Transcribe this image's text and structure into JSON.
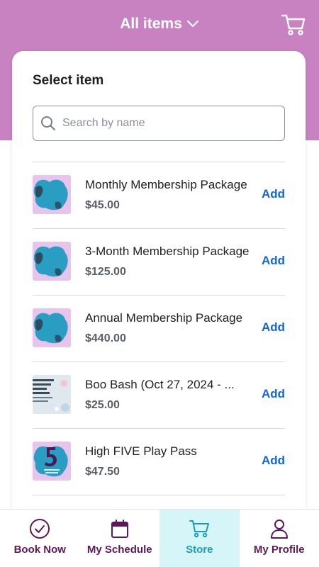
{
  "header": {
    "title": "All items"
  },
  "sheet": {
    "title": "Select item"
  },
  "search": {
    "placeholder": "Search by name"
  },
  "items": [
    {
      "name": "Monthly Membership Package",
      "price": "$45.00",
      "add_label": "Add",
      "thumb": "monthly-membership-thumbnail"
    },
    {
      "name": "3-Month Membership Package",
      "price": "$125.00",
      "add_label": "Add",
      "thumb": "3-month-membership-thumbnail"
    },
    {
      "name": "Annual Membership Package",
      "price": "$440.00",
      "add_label": "Add",
      "thumb": "annual-membership-thumbnail"
    },
    {
      "name": "Boo Bash (Oct 27, 2024 - ...",
      "price": "$25.00",
      "add_label": "Add",
      "thumb": "boo-bash-flyer-thumbnail"
    },
    {
      "name": "High FIVE Play Pass",
      "price": "$47.50",
      "add_label": "Add",
      "thumb": "high-five-play-pass-thumbnail"
    }
  ],
  "nav": [
    {
      "label": "Book Now",
      "icon": "check-circle-icon"
    },
    {
      "label": "My Schedule",
      "icon": "calendar-icon"
    },
    {
      "label": "Store",
      "icon": "cart-icon",
      "active": true
    },
    {
      "label": "My Profile",
      "icon": "person-icon"
    }
  ],
  "colors": {
    "brand": "#c882c2",
    "accent": "#1565d8",
    "nav_text": "#5b1a56",
    "active_nav": "#1a9fb0"
  }
}
